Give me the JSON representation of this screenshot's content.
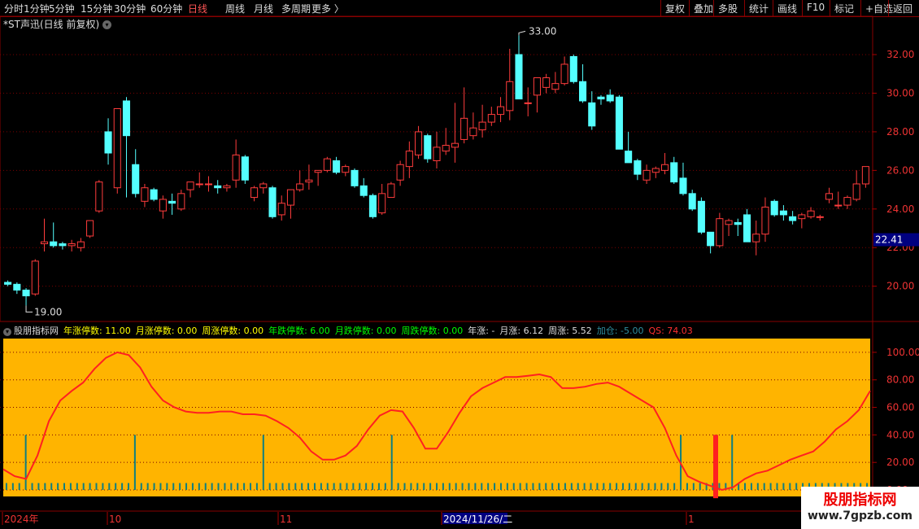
{
  "toolbar": {
    "periods": [
      "分时",
      "1分钟",
      "5分钟",
      "15分钟",
      "30分钟",
      "60分钟",
      "日线",
      "周线",
      "月线",
      "多周期",
      "更多 〉"
    ],
    "active_period": "日线",
    "right_buttons": [
      "复权",
      "叠加",
      "多股",
      "统计",
      "画线",
      "F10",
      "标记",
      "+自选",
      "返回"
    ]
  },
  "main_title": "*ST声迅(日线 前复权)",
  "price_axis_ticks": [
    "32.00",
    "30.00",
    "28.00",
    "26.00",
    "24.00",
    "22.00",
    "20.00"
  ],
  "current_price": "22.41",
  "high_label": "33.00",
  "low_label": "19.00",
  "indicator_header": [
    {
      "text": "股朋指标网",
      "color": "#dddddd"
    },
    {
      "text": "年涨停数: 11.00",
      "color": "#ffff00"
    },
    {
      "text": "月涨停数: 0.00",
      "color": "#ffff00"
    },
    {
      "text": "周涨停数: 0.00",
      "color": "#ffff00"
    },
    {
      "text": "年跌停数: 6.00",
      "color": "#00ff00"
    },
    {
      "text": "月跌停数: 0.00",
      "color": "#00ff00"
    },
    {
      "text": "周跌停数: 0.00",
      "color": "#00ff00"
    },
    {
      "text": "年涨: -",
      "color": "#dddddd"
    },
    {
      "text": "月涨: 6.12",
      "color": "#dddddd"
    },
    {
      "text": "周涨: 5.52",
      "color": "#dddddd"
    },
    {
      "text": "加仓: -5.00",
      "color": "#2f8fa0"
    },
    {
      "text": "QS: 74.03",
      "color": "#ff3030"
    }
  ],
  "indicator_axis_ticks": [
    "100.00",
    "80.00",
    "60.00",
    "40.00",
    "20.00",
    "0.00"
  ],
  "date_labels": [
    "2024年",
    "10",
    "11",
    "2024/11/26/二",
    "1"
  ],
  "watermark": {
    "title": "股朋指标网",
    "url": "www.7gpzb.com"
  },
  "colors": {
    "up": "#ff3c3c",
    "down": "#54ffff",
    "indicator_bg": "#ffb400",
    "qs_line": "#ff2020",
    "bar": "#0e7f80"
  },
  "chart_data": [
    {
      "type": "candlestick",
      "ylim": [
        18.3,
        33.9
      ],
      "candles": [
        [
          20.2,
          20.3,
          20.0,
          20.1
        ],
        [
          20.1,
          20.2,
          19.6,
          19.8
        ],
        [
          19.8,
          19.9,
          19.0,
          19.5
        ],
        [
          19.6,
          21.4,
          19.5,
          21.3
        ],
        [
          22.2,
          23.5,
          21.8,
          22.3
        ],
        [
          22.3,
          23.3,
          22.0,
          22.1
        ],
        [
          22.2,
          22.3,
          21.9,
          22.1
        ],
        [
          22.1,
          22.4,
          21.8,
          22.2
        ],
        [
          22.0,
          22.5,
          21.8,
          22.3
        ],
        [
          22.6,
          23.4,
          22.5,
          23.4
        ],
        [
          23.9,
          25.5,
          23.8,
          25.4
        ],
        [
          28.0,
          28.7,
          26.3,
          26.9
        ],
        [
          25.1,
          29.1,
          24.8,
          29.2
        ],
        [
          29.6,
          29.8,
          24.6,
          27.8
        ],
        [
          26.3,
          27.1,
          24.6,
          24.8
        ],
        [
          24.4,
          25.3,
          24.1,
          25.1
        ],
        [
          25.0,
          25.1,
          24.4,
          24.5
        ],
        [
          23.9,
          24.7,
          23.5,
          24.5
        ],
        [
          24.4,
          24.8,
          23.7,
          24.3
        ],
        [
          24.0,
          25.0,
          23.9,
          24.8
        ],
        [
          25.0,
          25.4,
          24.6,
          25.4
        ],
        [
          25.3,
          25.9,
          25.1,
          25.3
        ],
        [
          25.3,
          25.7,
          24.9,
          25.3
        ],
        [
          25.2,
          25.5,
          24.8,
          25.1
        ],
        [
          25.1,
          25.3,
          24.9,
          25.2
        ],
        [
          25.5,
          27.6,
          25.1,
          26.8
        ],
        [
          26.7,
          26.8,
          25.3,
          25.5
        ],
        [
          24.6,
          25.2,
          24.4,
          25.1
        ],
        [
          25.1,
          25.4,
          24.8,
          25.3
        ],
        [
          25.1,
          25.2,
          23.5,
          23.6
        ],
        [
          23.7,
          24.7,
          23.4,
          24.3
        ],
        [
          24.2,
          25.0,
          23.5,
          25.0
        ],
        [
          25.0,
          26.0,
          24.9,
          25.3
        ],
        [
          25.4,
          26.3,
          25.0,
          25.5
        ],
        [
          25.9,
          26.0,
          25.2,
          26.0
        ],
        [
          26.0,
          26.7,
          25.9,
          26.6
        ],
        [
          26.5,
          26.7,
          25.8,
          25.9
        ],
        [
          25.9,
          26.3,
          25.7,
          26.2
        ],
        [
          26.0,
          26.1,
          25.1,
          25.2
        ],
        [
          25.2,
          25.6,
          24.6,
          24.7
        ],
        [
          24.7,
          24.8,
          23.5,
          23.6
        ],
        [
          23.8,
          25.3,
          23.7,
          24.8
        ],
        [
          24.6,
          25.4,
          24.6,
          25.3
        ],
        [
          25.5,
          26.5,
          25.2,
          26.3
        ],
        [
          26.2,
          27.5,
          25.6,
          27.0
        ],
        [
          26.8,
          28.3,
          26.6,
          28.0
        ],
        [
          27.8,
          27.9,
          26.4,
          26.6
        ],
        [
          26.5,
          28.0,
          26.1,
          27.2
        ],
        [
          27.0,
          28.2,
          26.8,
          27.3
        ],
        [
          27.2,
          29.5,
          26.4,
          27.4
        ],
        [
          27.6,
          30.3,
          27.4,
          28.7
        ],
        [
          27.8,
          29.0,
          27.6,
          28.2
        ],
        [
          28.1,
          29.4,
          27.7,
          28.5
        ],
        [
          28.5,
          29.3,
          28.3,
          28.9
        ],
        [
          28.9,
          29.8,
          28.5,
          29.3
        ],
        [
          29.1,
          32.3,
          28.6,
          30.6
        ],
        [
          32.0,
          33.0,
          29.9,
          29.7
        ],
        [
          29.5,
          30.3,
          28.8,
          29.5
        ],
        [
          29.9,
          30.8,
          29.0,
          30.8
        ],
        [
          30.3,
          31.0,
          30.0,
          30.8
        ],
        [
          30.2,
          31.1,
          30.0,
          30.5
        ],
        [
          30.5,
          31.9,
          30.4,
          31.5
        ],
        [
          31.9,
          32.0,
          30.5,
          30.6
        ],
        [
          30.6,
          31.5,
          29.5,
          29.6
        ],
        [
          29.5,
          30.1,
          28.1,
          28.3
        ],
        [
          29.8,
          29.9,
          29.4,
          29.7
        ],
        [
          29.9,
          30.2,
          29.5,
          29.6
        ],
        [
          29.8,
          29.9,
          27.1,
          27.1
        ],
        [
          27.0,
          28.0,
          26.4,
          26.4
        ],
        [
          26.5,
          26.6,
          25.5,
          25.8
        ],
        [
          25.5,
          26.3,
          25.3,
          26.0
        ],
        [
          25.9,
          26.2,
          25.6,
          26.1
        ],
        [
          26.0,
          26.9,
          25.8,
          26.3
        ],
        [
          26.4,
          26.7,
          25.3,
          25.4
        ],
        [
          25.6,
          26.4,
          24.7,
          24.8
        ],
        [
          24.8,
          25.0,
          23.9,
          24.0
        ],
        [
          24.4,
          24.6,
          22.7,
          22.8
        ],
        [
          22.8,
          22.8,
          21.7,
          22.1
        ],
        [
          22.1,
          23.8,
          22.0,
          23.5
        ],
        [
          23.2,
          23.5,
          22.6,
          23.4
        ],
        [
          23.3,
          23.5,
          22.6,
          23.2
        ],
        [
          23.7,
          24.0,
          22.5,
          22.3
        ],
        [
          22.3,
          23.4,
          21.6,
          22.7
        ],
        [
          22.7,
          24.6,
          22.3,
          24.1
        ],
        [
          24.4,
          24.5,
          23.6,
          23.7
        ],
        [
          23.9,
          24.2,
          23.4,
          23.7
        ],
        [
          23.6,
          23.9,
          23.2,
          23.4
        ],
        [
          23.5,
          23.8,
          23.0,
          23.7
        ],
        [
          23.6,
          24.1,
          23.5,
          23.9
        ],
        [
          23.6,
          23.7,
          23.4,
          23.6
        ],
        [
          24.5,
          25.1,
          24.3,
          24.8
        ],
        [
          24.2,
          24.9,
          24.0,
          24.2
        ],
        [
          24.2,
          24.7,
          24.0,
          24.6
        ],
        [
          24.5,
          26.0,
          24.4,
          25.3
        ],
        [
          25.3,
          25.9,
          25.1,
          26.2
        ]
      ]
    },
    {
      "type": "line",
      "ylim": [
        0,
        110
      ],
      "series": [
        {
          "values": [
            15,
            10,
            8,
            25,
            50,
            65,
            72,
            78,
            88,
            96,
            100,
            98,
            89,
            75,
            65,
            60,
            57,
            56,
            56,
            57,
            57,
            55,
            55,
            54,
            50,
            45,
            38,
            28,
            22,
            22,
            25,
            32,
            44,
            54,
            58,
            57,
            45,
            30,
            30,
            42,
            56,
            68,
            74,
            78,
            82,
            82,
            83,
            84,
            82,
            74,
            74,
            75,
            77,
            78,
            75,
            70,
            65,
            60,
            45,
            25,
            10,
            6,
            3,
            0,
            2,
            8,
            12,
            14,
            18,
            22,
            25,
            28,
            35,
            44,
            50,
            58,
            72
          ]
        }
      ],
      "bars": [
        0,
        0,
        0,
        40,
        0,
        0,
        0,
        0,
        0,
        0,
        0,
        0,
        0,
        0,
        0,
        0,
        0,
        0,
        0,
        0,
        40,
        0,
        0,
        0,
        0,
        0,
        0,
        0,
        0,
        0,
        0,
        0,
        0,
        0,
        0,
        0,
        0,
        0,
        0,
        0,
        40,
        0,
        0,
        0,
        0,
        0,
        0,
        0,
        0,
        0,
        0,
        0,
        0,
        0,
        0,
        0,
        0,
        0,
        0,
        0,
        40,
        0,
        0,
        0,
        0,
        0,
        0,
        0,
        0,
        0,
        0,
        0,
        0,
        0,
        0,
        0,
        0,
        0,
        0,
        0,
        0,
        0,
        0,
        0,
        0,
        0,
        0,
        0,
        0,
        0,
        0,
        0,
        0,
        0,
        0,
        0,
        0,
        0,
        0,
        0,
        0,
        0,
        0,
        0,
        0,
        40,
        0,
        0,
        0,
        0,
        0,
        0,
        0,
        40,
        0,
        0,
        0,
        0,
        0,
        0,
        0,
        0,
        0,
        0,
        0,
        0,
        0,
        0,
        0,
        0,
        0,
        0,
        0,
        0,
        0
      ]
    }
  ]
}
